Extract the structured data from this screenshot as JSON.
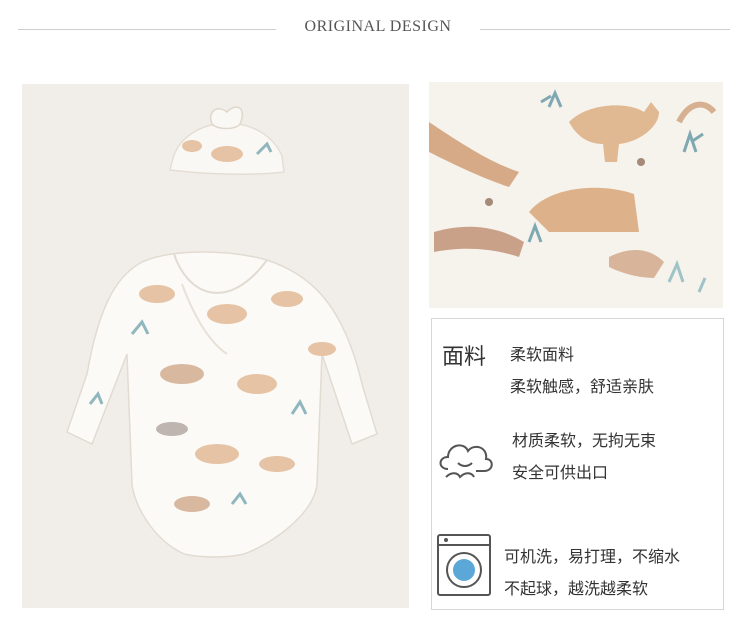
{
  "header": {
    "title": "ORIGINAL DESIGN"
  },
  "features": [
    {
      "icon": "fabric-text-icon",
      "icon_label": "面料",
      "line1": "柔软面料",
      "line2": "柔软触感，舒适亲肤"
    },
    {
      "icon": "cloud-icon",
      "line1": "材质柔软，无拘无束",
      "line2": "安全可供出口"
    },
    {
      "icon": "washing-machine-icon",
      "line1": "可机洗，易打理，不缩水",
      "line2": "不起球，越洗越柔软"
    }
  ],
  "colors": {
    "print_beige": "#e6c3a4",
    "print_leaf": "#8fb7bd",
    "accent_blue": "#5aa7d8"
  }
}
